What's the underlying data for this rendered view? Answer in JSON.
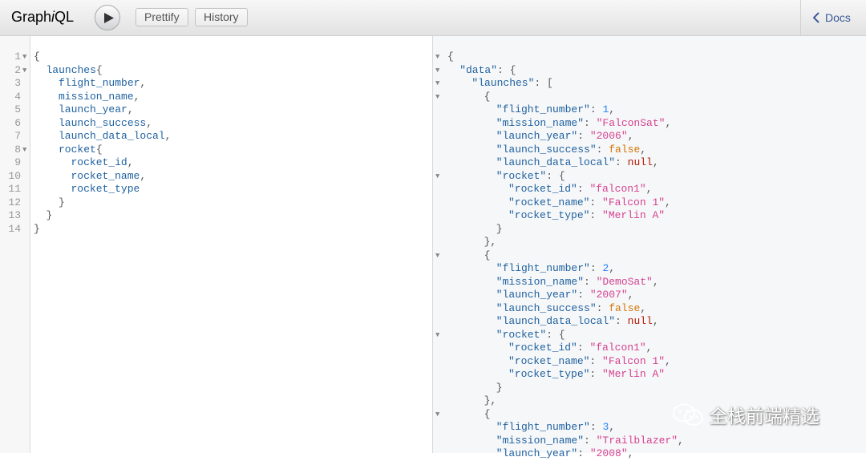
{
  "app": {
    "logo_prefix": "Graph",
    "logo_italic": "i",
    "logo_suffix": "QL"
  },
  "toolbar": {
    "prettify_label": "Prettify",
    "history_label": "History",
    "docs_label": "Docs"
  },
  "editor": {
    "lines": [
      {
        "num": "1",
        "fold": true,
        "indent": 0,
        "tokens": [
          [
            "punc",
            "{"
          ]
        ]
      },
      {
        "num": "2",
        "fold": true,
        "indent": 1,
        "tokens": [
          [
            "field",
            "launches"
          ],
          [
            "punc",
            "{"
          ]
        ]
      },
      {
        "num": "3",
        "fold": false,
        "indent": 2,
        "tokens": [
          [
            "field",
            "flight_number"
          ],
          [
            "punc",
            ","
          ]
        ]
      },
      {
        "num": "4",
        "fold": false,
        "indent": 2,
        "tokens": [
          [
            "field",
            "mission_name"
          ],
          [
            "punc",
            ","
          ]
        ]
      },
      {
        "num": "5",
        "fold": false,
        "indent": 2,
        "tokens": [
          [
            "field",
            "launch_year"
          ],
          [
            "punc",
            ","
          ]
        ]
      },
      {
        "num": "6",
        "fold": false,
        "indent": 2,
        "tokens": [
          [
            "field",
            "launch_success"
          ],
          [
            "punc",
            ","
          ]
        ]
      },
      {
        "num": "7",
        "fold": false,
        "indent": 2,
        "tokens": [
          [
            "field",
            "launch_data_local"
          ],
          [
            "punc",
            ","
          ]
        ]
      },
      {
        "num": "8",
        "fold": true,
        "indent": 2,
        "tokens": [
          [
            "field",
            "rocket"
          ],
          [
            "punc",
            "{"
          ]
        ]
      },
      {
        "num": "9",
        "fold": false,
        "indent": 3,
        "tokens": [
          [
            "field",
            "rocket_id"
          ],
          [
            "punc",
            ","
          ]
        ]
      },
      {
        "num": "10",
        "fold": false,
        "indent": 3,
        "tokens": [
          [
            "field",
            "rocket_name"
          ],
          [
            "punc",
            ","
          ]
        ]
      },
      {
        "num": "11",
        "fold": false,
        "indent": 3,
        "tokens": [
          [
            "field",
            "rocket_type"
          ]
        ]
      },
      {
        "num": "12",
        "fold": false,
        "indent": 2,
        "tokens": [
          [
            "punc",
            "}"
          ]
        ]
      },
      {
        "num": "13",
        "fold": false,
        "indent": 1,
        "tokens": [
          [
            "punc",
            "}"
          ]
        ]
      },
      {
        "num": "14",
        "fold": false,
        "indent": 0,
        "tokens": [
          [
            "punc",
            "}"
          ]
        ]
      }
    ]
  },
  "result": {
    "lines": [
      {
        "fold": true,
        "indent": 0,
        "tokens": [
          [
            "punc",
            "{"
          ]
        ]
      },
      {
        "fold": true,
        "indent": 1,
        "tokens": [
          [
            "key",
            "\"data\""
          ],
          [
            "punc",
            ": {"
          ]
        ]
      },
      {
        "fold": true,
        "indent": 2,
        "tokens": [
          [
            "key",
            "\"launches\""
          ],
          [
            "punc",
            ": ["
          ]
        ]
      },
      {
        "fold": true,
        "indent": 3,
        "tokens": [
          [
            "punc",
            "{"
          ]
        ]
      },
      {
        "fold": false,
        "indent": 4,
        "tokens": [
          [
            "key",
            "\"flight_number\""
          ],
          [
            "punc",
            ": "
          ],
          [
            "num",
            "1"
          ],
          [
            "punc",
            ","
          ]
        ]
      },
      {
        "fold": false,
        "indent": 4,
        "tokens": [
          [
            "key",
            "\"mission_name\""
          ],
          [
            "punc",
            ": "
          ],
          [
            "str",
            "\"FalconSat\""
          ],
          [
            "punc",
            ","
          ]
        ]
      },
      {
        "fold": false,
        "indent": 4,
        "tokens": [
          [
            "key",
            "\"launch_year\""
          ],
          [
            "punc",
            ": "
          ],
          [
            "str",
            "\"2006\""
          ],
          [
            "punc",
            ","
          ]
        ]
      },
      {
        "fold": false,
        "indent": 4,
        "tokens": [
          [
            "key",
            "\"launch_success\""
          ],
          [
            "punc",
            ": "
          ],
          [
            "bool",
            "false"
          ],
          [
            "punc",
            ","
          ]
        ]
      },
      {
        "fold": false,
        "indent": 4,
        "tokens": [
          [
            "key",
            "\"launch_data_local\""
          ],
          [
            "punc",
            ": "
          ],
          [
            "kw",
            "null"
          ],
          [
            "punc",
            ","
          ]
        ]
      },
      {
        "fold": true,
        "indent": 4,
        "tokens": [
          [
            "key",
            "\"rocket\""
          ],
          [
            "punc",
            ": {"
          ]
        ]
      },
      {
        "fold": false,
        "indent": 5,
        "tokens": [
          [
            "key",
            "\"rocket_id\""
          ],
          [
            "punc",
            ": "
          ],
          [
            "str",
            "\"falcon1\""
          ],
          [
            "punc",
            ","
          ]
        ]
      },
      {
        "fold": false,
        "indent": 5,
        "tokens": [
          [
            "key",
            "\"rocket_name\""
          ],
          [
            "punc",
            ": "
          ],
          [
            "str",
            "\"Falcon 1\""
          ],
          [
            "punc",
            ","
          ]
        ]
      },
      {
        "fold": false,
        "indent": 5,
        "tokens": [
          [
            "key",
            "\"rocket_type\""
          ],
          [
            "punc",
            ": "
          ],
          [
            "str",
            "\"Merlin A\""
          ]
        ]
      },
      {
        "fold": false,
        "indent": 4,
        "tokens": [
          [
            "punc",
            "}"
          ]
        ]
      },
      {
        "fold": false,
        "indent": 3,
        "tokens": [
          [
            "punc",
            "},"
          ]
        ]
      },
      {
        "fold": true,
        "indent": 3,
        "tokens": [
          [
            "punc",
            "{"
          ]
        ]
      },
      {
        "fold": false,
        "indent": 4,
        "tokens": [
          [
            "key",
            "\"flight_number\""
          ],
          [
            "punc",
            ": "
          ],
          [
            "num",
            "2"
          ],
          [
            "punc",
            ","
          ]
        ]
      },
      {
        "fold": false,
        "indent": 4,
        "tokens": [
          [
            "key",
            "\"mission_name\""
          ],
          [
            "punc",
            ": "
          ],
          [
            "str",
            "\"DemoSat\""
          ],
          [
            "punc",
            ","
          ]
        ]
      },
      {
        "fold": false,
        "indent": 4,
        "tokens": [
          [
            "key",
            "\"launch_year\""
          ],
          [
            "punc",
            ": "
          ],
          [
            "str",
            "\"2007\""
          ],
          [
            "punc",
            ","
          ]
        ]
      },
      {
        "fold": false,
        "indent": 4,
        "tokens": [
          [
            "key",
            "\"launch_success\""
          ],
          [
            "punc",
            ": "
          ],
          [
            "bool",
            "false"
          ],
          [
            "punc",
            ","
          ]
        ]
      },
      {
        "fold": false,
        "indent": 4,
        "tokens": [
          [
            "key",
            "\"launch_data_local\""
          ],
          [
            "punc",
            ": "
          ],
          [
            "kw",
            "null"
          ],
          [
            "punc",
            ","
          ]
        ]
      },
      {
        "fold": true,
        "indent": 4,
        "tokens": [
          [
            "key",
            "\"rocket\""
          ],
          [
            "punc",
            ": {"
          ]
        ]
      },
      {
        "fold": false,
        "indent": 5,
        "tokens": [
          [
            "key",
            "\"rocket_id\""
          ],
          [
            "punc",
            ": "
          ],
          [
            "str",
            "\"falcon1\""
          ],
          [
            "punc",
            ","
          ]
        ]
      },
      {
        "fold": false,
        "indent": 5,
        "tokens": [
          [
            "key",
            "\"rocket_name\""
          ],
          [
            "punc",
            ": "
          ],
          [
            "str",
            "\"Falcon 1\""
          ],
          [
            "punc",
            ","
          ]
        ]
      },
      {
        "fold": false,
        "indent": 5,
        "tokens": [
          [
            "key",
            "\"rocket_type\""
          ],
          [
            "punc",
            ": "
          ],
          [
            "str",
            "\"Merlin A\""
          ]
        ]
      },
      {
        "fold": false,
        "indent": 4,
        "tokens": [
          [
            "punc",
            "}"
          ]
        ]
      },
      {
        "fold": false,
        "indent": 3,
        "tokens": [
          [
            "punc",
            "},"
          ]
        ]
      },
      {
        "fold": true,
        "indent": 3,
        "tokens": [
          [
            "punc",
            "{"
          ]
        ]
      },
      {
        "fold": false,
        "indent": 4,
        "tokens": [
          [
            "key",
            "\"flight_number\""
          ],
          [
            "punc",
            ": "
          ],
          [
            "num",
            "3"
          ],
          [
            "punc",
            ","
          ]
        ]
      },
      {
        "fold": false,
        "indent": 4,
        "tokens": [
          [
            "key",
            "\"mission_name\""
          ],
          [
            "punc",
            ": "
          ],
          [
            "str",
            "\"Trailblazer\""
          ],
          [
            "punc",
            ","
          ]
        ]
      },
      {
        "fold": false,
        "indent": 4,
        "tokens": [
          [
            "key",
            "\"launch_year\""
          ],
          [
            "punc",
            ": "
          ],
          [
            "str",
            "\"2008\""
          ],
          [
            "punc",
            ","
          ]
        ]
      }
    ]
  },
  "watermark": {
    "text": "全栈前端精选",
    "icon": "wechat-icon"
  },
  "icons": {
    "run": "play-icon",
    "docs": "chevron-left-icon",
    "fold": "fold-arrow-icon"
  },
  "colors": {
    "field": "#1f61a0",
    "key": "#1f61a0",
    "string": "#d64292",
    "number": "#2882f9",
    "null": "#b11a04",
    "boolean": "#d47509",
    "docs_link": "#3b5998"
  }
}
